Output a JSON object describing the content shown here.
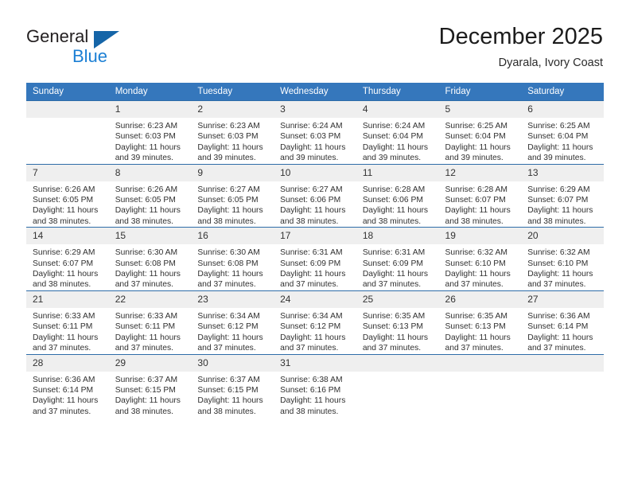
{
  "brand": {
    "line1": "General",
    "line2": "Blue",
    "triangle_icon": "triangle-icon",
    "color_primary": "#1565a8",
    "color_secondary": "#1b7fd4"
  },
  "header": {
    "month_title": "December 2025",
    "location": "Dyarala, Ivory Coast"
  },
  "calendar": {
    "header_bg": "#3577bc",
    "daynum_bg": "#efefef",
    "row_border": "#2e6ca8",
    "weekdays": [
      "Sunday",
      "Monday",
      "Tuesday",
      "Wednesday",
      "Thursday",
      "Friday",
      "Saturday"
    ],
    "weeks": [
      [
        {
          "day": "",
          "sunrise": "",
          "sunset": "",
          "daylight1": "",
          "daylight2": "",
          "empty": true
        },
        {
          "day": "1",
          "sunrise": "Sunrise: 6:23 AM",
          "sunset": "Sunset: 6:03 PM",
          "daylight1": "Daylight: 11 hours",
          "daylight2": "and 39 minutes."
        },
        {
          "day": "2",
          "sunrise": "Sunrise: 6:23 AM",
          "sunset": "Sunset: 6:03 PM",
          "daylight1": "Daylight: 11 hours",
          "daylight2": "and 39 minutes."
        },
        {
          "day": "3",
          "sunrise": "Sunrise: 6:24 AM",
          "sunset": "Sunset: 6:03 PM",
          "daylight1": "Daylight: 11 hours",
          "daylight2": "and 39 minutes."
        },
        {
          "day": "4",
          "sunrise": "Sunrise: 6:24 AM",
          "sunset": "Sunset: 6:04 PM",
          "daylight1": "Daylight: 11 hours",
          "daylight2": "and 39 minutes."
        },
        {
          "day": "5",
          "sunrise": "Sunrise: 6:25 AM",
          "sunset": "Sunset: 6:04 PM",
          "daylight1": "Daylight: 11 hours",
          "daylight2": "and 39 minutes."
        },
        {
          "day": "6",
          "sunrise": "Sunrise: 6:25 AM",
          "sunset": "Sunset: 6:04 PM",
          "daylight1": "Daylight: 11 hours",
          "daylight2": "and 39 minutes."
        }
      ],
      [
        {
          "day": "7",
          "sunrise": "Sunrise: 6:26 AM",
          "sunset": "Sunset: 6:05 PM",
          "daylight1": "Daylight: 11 hours",
          "daylight2": "and 38 minutes."
        },
        {
          "day": "8",
          "sunrise": "Sunrise: 6:26 AM",
          "sunset": "Sunset: 6:05 PM",
          "daylight1": "Daylight: 11 hours",
          "daylight2": "and 38 minutes."
        },
        {
          "day": "9",
          "sunrise": "Sunrise: 6:27 AM",
          "sunset": "Sunset: 6:05 PM",
          "daylight1": "Daylight: 11 hours",
          "daylight2": "and 38 minutes."
        },
        {
          "day": "10",
          "sunrise": "Sunrise: 6:27 AM",
          "sunset": "Sunset: 6:06 PM",
          "daylight1": "Daylight: 11 hours",
          "daylight2": "and 38 minutes."
        },
        {
          "day": "11",
          "sunrise": "Sunrise: 6:28 AM",
          "sunset": "Sunset: 6:06 PM",
          "daylight1": "Daylight: 11 hours",
          "daylight2": "and 38 minutes."
        },
        {
          "day": "12",
          "sunrise": "Sunrise: 6:28 AM",
          "sunset": "Sunset: 6:07 PM",
          "daylight1": "Daylight: 11 hours",
          "daylight2": "and 38 minutes."
        },
        {
          "day": "13",
          "sunrise": "Sunrise: 6:29 AM",
          "sunset": "Sunset: 6:07 PM",
          "daylight1": "Daylight: 11 hours",
          "daylight2": "and 38 minutes."
        }
      ],
      [
        {
          "day": "14",
          "sunrise": "Sunrise: 6:29 AM",
          "sunset": "Sunset: 6:07 PM",
          "daylight1": "Daylight: 11 hours",
          "daylight2": "and 38 minutes."
        },
        {
          "day": "15",
          "sunrise": "Sunrise: 6:30 AM",
          "sunset": "Sunset: 6:08 PM",
          "daylight1": "Daylight: 11 hours",
          "daylight2": "and 37 minutes."
        },
        {
          "day": "16",
          "sunrise": "Sunrise: 6:30 AM",
          "sunset": "Sunset: 6:08 PM",
          "daylight1": "Daylight: 11 hours",
          "daylight2": "and 37 minutes."
        },
        {
          "day": "17",
          "sunrise": "Sunrise: 6:31 AM",
          "sunset": "Sunset: 6:09 PM",
          "daylight1": "Daylight: 11 hours",
          "daylight2": "and 37 minutes."
        },
        {
          "day": "18",
          "sunrise": "Sunrise: 6:31 AM",
          "sunset": "Sunset: 6:09 PM",
          "daylight1": "Daylight: 11 hours",
          "daylight2": "and 37 minutes."
        },
        {
          "day": "19",
          "sunrise": "Sunrise: 6:32 AM",
          "sunset": "Sunset: 6:10 PM",
          "daylight1": "Daylight: 11 hours",
          "daylight2": "and 37 minutes."
        },
        {
          "day": "20",
          "sunrise": "Sunrise: 6:32 AM",
          "sunset": "Sunset: 6:10 PM",
          "daylight1": "Daylight: 11 hours",
          "daylight2": "and 37 minutes."
        }
      ],
      [
        {
          "day": "21",
          "sunrise": "Sunrise: 6:33 AM",
          "sunset": "Sunset: 6:11 PM",
          "daylight1": "Daylight: 11 hours",
          "daylight2": "and 37 minutes."
        },
        {
          "day": "22",
          "sunrise": "Sunrise: 6:33 AM",
          "sunset": "Sunset: 6:11 PM",
          "daylight1": "Daylight: 11 hours",
          "daylight2": "and 37 minutes."
        },
        {
          "day": "23",
          "sunrise": "Sunrise: 6:34 AM",
          "sunset": "Sunset: 6:12 PM",
          "daylight1": "Daylight: 11 hours",
          "daylight2": "and 37 minutes."
        },
        {
          "day": "24",
          "sunrise": "Sunrise: 6:34 AM",
          "sunset": "Sunset: 6:12 PM",
          "daylight1": "Daylight: 11 hours",
          "daylight2": "and 37 minutes."
        },
        {
          "day": "25",
          "sunrise": "Sunrise: 6:35 AM",
          "sunset": "Sunset: 6:13 PM",
          "daylight1": "Daylight: 11 hours",
          "daylight2": "and 37 minutes."
        },
        {
          "day": "26",
          "sunrise": "Sunrise: 6:35 AM",
          "sunset": "Sunset: 6:13 PM",
          "daylight1": "Daylight: 11 hours",
          "daylight2": "and 37 minutes."
        },
        {
          "day": "27",
          "sunrise": "Sunrise: 6:36 AM",
          "sunset": "Sunset: 6:14 PM",
          "daylight1": "Daylight: 11 hours",
          "daylight2": "and 37 minutes."
        }
      ],
      [
        {
          "day": "28",
          "sunrise": "Sunrise: 6:36 AM",
          "sunset": "Sunset: 6:14 PM",
          "daylight1": "Daylight: 11 hours",
          "daylight2": "and 37 minutes."
        },
        {
          "day": "29",
          "sunrise": "Sunrise: 6:37 AM",
          "sunset": "Sunset: 6:15 PM",
          "daylight1": "Daylight: 11 hours",
          "daylight2": "and 38 minutes."
        },
        {
          "day": "30",
          "sunrise": "Sunrise: 6:37 AM",
          "sunset": "Sunset: 6:15 PM",
          "daylight1": "Daylight: 11 hours",
          "daylight2": "and 38 minutes."
        },
        {
          "day": "31",
          "sunrise": "Sunrise: 6:38 AM",
          "sunset": "Sunset: 6:16 PM",
          "daylight1": "Daylight: 11 hours",
          "daylight2": "and 38 minutes."
        },
        {
          "day": "",
          "sunrise": "",
          "sunset": "",
          "daylight1": "",
          "daylight2": "",
          "empty": true
        },
        {
          "day": "",
          "sunrise": "",
          "sunset": "",
          "daylight1": "",
          "daylight2": "",
          "empty": true
        },
        {
          "day": "",
          "sunrise": "",
          "sunset": "",
          "daylight1": "",
          "daylight2": "",
          "empty": true
        }
      ]
    ]
  }
}
